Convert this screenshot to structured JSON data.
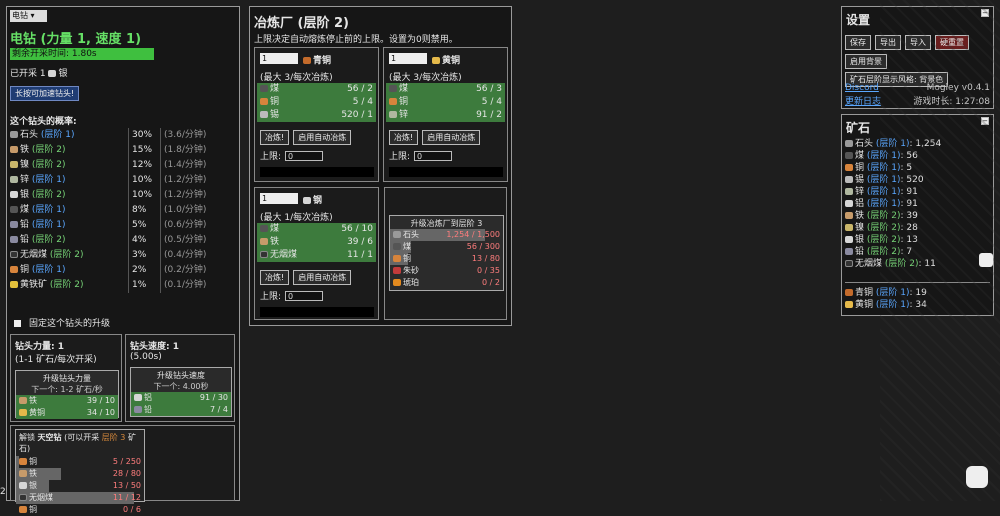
{
  "drill": {
    "select_value": "电钻",
    "title": "电钻 (力量 1, 速度 1)",
    "timer": "剩余开采时间:  1.80s",
    "mined_prefix": "已开采 1",
    "mined_item": "银",
    "speedup_button": "长按可加速钻头!",
    "prob_title": "这个钻头的概率:",
    "probabilities": [
      {
        "name": "石头",
        "tier": "(层阶 1)",
        "tier_class": "tier1",
        "icon": "stone",
        "pct": "30%",
        "rate": "(3.6/分钟)"
      },
      {
        "name": "铁",
        "tier": "(层阶 2)",
        "tier_class": "tier2",
        "icon": "iron",
        "pct": "15%",
        "rate": "(1.8/分钟)"
      },
      {
        "name": "镍",
        "tier": "(层阶 2)",
        "tier_class": "tier2",
        "icon": "nickel",
        "pct": "12%",
        "rate": "(1.4/分钟)"
      },
      {
        "name": "锌",
        "tier": "(层阶 1)",
        "tier_class": "tier1",
        "icon": "zinc",
        "pct": "10%",
        "rate": "(1.2/分钟)"
      },
      {
        "name": "银",
        "tier": "(层阶 2)",
        "tier_class": "tier2",
        "icon": "silver",
        "pct": "10%",
        "rate": "(1.2/分钟)"
      },
      {
        "name": "煤",
        "tier": "(层阶 1)",
        "tier_class": "tier1",
        "icon": "coal",
        "pct": "8%",
        "rate": "(1.0/分钟)"
      },
      {
        "name": "铅",
        "tier": "(层阶 1)",
        "tier_class": "tier1",
        "icon": "lead",
        "pct": "5%",
        "rate": "(0.6/分钟)"
      },
      {
        "name": "铅",
        "tier": "(层阶 2)",
        "tier_class": "tier2",
        "icon": "lead",
        "pct": "4%",
        "rate": "(0.5/分钟)"
      },
      {
        "name": "无烟煤",
        "tier": "(层阶 2)",
        "tier_class": "tier2",
        "icon": "anth",
        "pct": "3%",
        "rate": "(0.4/分钟)"
      },
      {
        "name": "铜",
        "tier": "(层阶 1)",
        "tier_class": "tier1",
        "icon": "copper",
        "pct": "2%",
        "rate": "(0.2/分钟)"
      },
      {
        "name": "黄铁矿",
        "tier": "(层阶 2)",
        "tier_class": "tier2",
        "icon": "pyrite",
        "pct": "1%",
        "rate": "(0.1/分钟)"
      }
    ],
    "lock_label": "固定这个钻头的升级",
    "power": {
      "title": "钻头力量: 1",
      "subtitle": "(1-1 矿石/每次开采)",
      "upgrade_title": "升级钻头力量",
      "upgrade_next": "下一个: 1-2 矿石/秒",
      "costs": [
        {
          "name": "铁",
          "icon": "iron",
          "amount": "39 / 10"
        },
        {
          "name": "黄铜",
          "icon": "brass",
          "amount": "34 / 10"
        }
      ]
    },
    "speed": {
      "title": "钻头速度: 1",
      "subtitle": "(5.00s)",
      "upgrade_title": "升级钻头速度",
      "upgrade_next": "下一个: 4.00秒",
      "costs": [
        {
          "name": "铝",
          "icon": "silver",
          "amount": "91 / 30"
        },
        {
          "name": "铅",
          "icon": "lead",
          "amount": "7 / 4"
        }
      ]
    },
    "unlock": {
      "prefix": "解锁",
      "name": "天空钻",
      "mid": "(可以开采",
      "tier": "层阶 3",
      "suffix": "矿石)",
      "costs": [
        {
          "name": "铜",
          "icon": "copper",
          "amount": "5 / 250",
          "fill": 0.02
        },
        {
          "name": "铁",
          "icon": "iron",
          "amount": "28 / 80",
          "fill": 0.35
        },
        {
          "name": "银",
          "icon": "silver",
          "amount": "13 / 50",
          "fill": 0.26
        },
        {
          "name": "无烟煤",
          "icon": "anth",
          "amount": "11 / 12",
          "fill": 0.92
        },
        {
          "name": "铜",
          "icon": "copper",
          "amount": "0 / 6",
          "fill": 0
        }
      ]
    }
  },
  "smelter": {
    "title": "冶炼厂 (层阶 2)",
    "description": "上限决定自动熔炼停止前的上限。设置为0则禁用。",
    "smelt_button": "冶炼!",
    "auto_button": "启用自动冶炼",
    "limit_label": "上限:",
    "units": [
      {
        "qty": "1",
        "name": "青铜",
        "icon": "bronze",
        "max": "(最大 3/每次冶炼)",
        "limit": "0",
        "ingredients": [
          {
            "name": "煤",
            "icon": "coal",
            "amount": "56 / 2"
          },
          {
            "name": "铜",
            "icon": "copper",
            "amount": "5 / 4"
          },
          {
            "name": "锡",
            "icon": "tin",
            "amount": "520 / 1"
          }
        ]
      },
      {
        "qty": "1",
        "name": "黄铜",
        "icon": "brass",
        "max": "(最大 3/每次冶炼)",
        "limit": "0",
        "ingredients": [
          {
            "name": "煤",
            "icon": "coal",
            "amount": "56 / 3"
          },
          {
            "name": "铜",
            "icon": "copper",
            "amount": "5 / 4"
          },
          {
            "name": "锌",
            "icon": "zinc",
            "amount": "91 / 2"
          }
        ]
      },
      {
        "qty": "1",
        "name": "钢",
        "icon": "silver",
        "max": "(最大 1/每次冶炼)",
        "limit": "0",
        "ingredients": [
          {
            "name": "煤",
            "icon": "coal",
            "amount": "56 / 10"
          },
          {
            "name": "铁",
            "icon": "iron",
            "amount": "39 / 6"
          },
          {
            "name": "无烟煤",
            "icon": "anth",
            "amount": "11 / 1"
          }
        ]
      }
    ],
    "upgrade": {
      "title": "升级冶炼厂到层阶 3",
      "costs": [
        {
          "name": "石头",
          "icon": "stone",
          "amount": "1,254 / 1,500",
          "fill": 0.84
        },
        {
          "name": "煤",
          "icon": "coal",
          "amount": "56 / 300",
          "fill": 0.19
        },
        {
          "name": "铜",
          "icon": "copper",
          "amount": "13 / 80",
          "fill": 0.16
        },
        {
          "name": "朱砂",
          "icon": "cinnabar",
          "amount": "0 / 35",
          "fill": 0
        },
        {
          "name": "琥珀",
          "icon": "amber",
          "amount": "0 / 2",
          "fill": 0
        }
      ]
    }
  },
  "settings": {
    "title": "设置",
    "buttons": [
      "保存",
      "导出",
      "导入",
      "硬重置"
    ],
    "bg_button": "启用背景",
    "style_button": "矿石层阶显示风格: 背景色",
    "discord": "Discord",
    "version": "Mogley v0.4.1",
    "changelog": "更新日志",
    "playtime": "游戏时长: 1:27:08"
  },
  "ores": {
    "title": "矿石",
    "items": [
      {
        "name": "石头",
        "tier": "(层阶 1)",
        "tier_class": "tier1",
        "icon": "stone",
        "count": "1,254"
      },
      {
        "name": "煤",
        "tier": "(层阶 1)",
        "tier_class": "tier1",
        "icon": "coal",
        "count": "56"
      },
      {
        "name": "铜",
        "tier": "(层阶 1)",
        "tier_class": "tier1",
        "icon": "copper",
        "count": "5"
      },
      {
        "name": "锡",
        "tier": "(层阶 1)",
        "tier_class": "tier1",
        "icon": "tin",
        "count": "520"
      },
      {
        "name": "锌",
        "tier": "(层阶 1)",
        "tier_class": "tier1",
        "icon": "zinc",
        "count": "91"
      },
      {
        "name": "铝",
        "tier": "(层阶 1)",
        "tier_class": "tier1",
        "icon": "silver",
        "count": "91"
      },
      {
        "name": "铁",
        "tier": "(层阶 2)",
        "tier_class": "tier2",
        "icon": "iron",
        "count": "39"
      },
      {
        "name": "镍",
        "tier": "(层阶 2)",
        "tier_class": "tier2",
        "icon": "nickel",
        "count": "28"
      },
      {
        "name": "银",
        "tier": "(层阶 2)",
        "tier_class": "tier2",
        "icon": "silver",
        "count": "13"
      },
      {
        "name": "铅",
        "tier": "(层阶 2)",
        "tier_class": "tier2",
        "icon": "lead",
        "count": "7"
      },
      {
        "name": "无烟煤",
        "tier": "(层阶 2)",
        "tier_class": "tier2",
        "icon": "anth",
        "count": "11"
      }
    ],
    "alloys": [
      {
        "name": "青铜",
        "tier": "(层阶 1)",
        "tier_class": "tier1",
        "icon": "bronze",
        "count": "19"
      },
      {
        "name": "黄铜",
        "tier": "(层阶 1)",
        "tier_class": "tier1",
        "icon": "brass",
        "count": "34"
      }
    ]
  },
  "corner_digit": "2"
}
